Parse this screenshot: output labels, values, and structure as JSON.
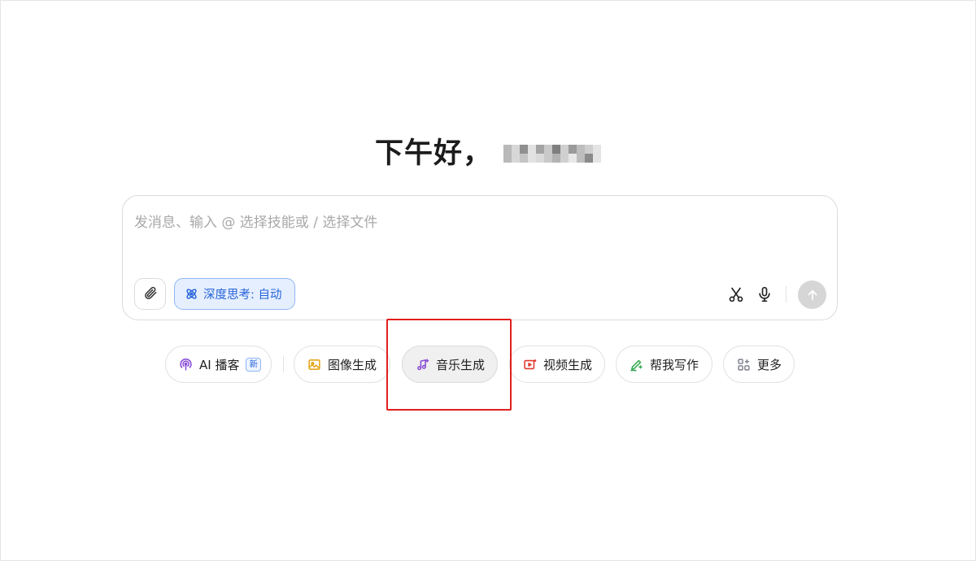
{
  "greeting": {
    "text": "下午好，"
  },
  "composer": {
    "placeholder": "发消息、输入 @ 选择技能或 / 选择文件",
    "value": "",
    "deep_think_label": "深度思考: 自动"
  },
  "icons": {
    "attach": "paperclip-icon",
    "deep_think": "atom-icon",
    "scissors": "scissors-icon",
    "mic": "microphone-icon",
    "send": "arrow-up-icon"
  },
  "quick_actions": [
    {
      "label": "AI 播客",
      "icon": "podcast-icon",
      "badge": "新"
    },
    {
      "label": "图像生成",
      "icon": "image-icon"
    },
    {
      "label": "音乐生成",
      "icon": "music-note-icon"
    },
    {
      "label": "视频生成",
      "icon": "video-icon"
    },
    {
      "label": "帮我写作",
      "icon": "pen-icon"
    },
    {
      "label": "更多",
      "icon": "grid-icon"
    }
  ],
  "colors": {
    "accent_blue": "#2664d9",
    "podcast": "#8a4fd6",
    "image": "#e3a51a",
    "music": "#8a4fd6",
    "video": "#e0392e",
    "write": "#34a853",
    "more": "#7a7f8a",
    "highlight": "#e0201e"
  }
}
